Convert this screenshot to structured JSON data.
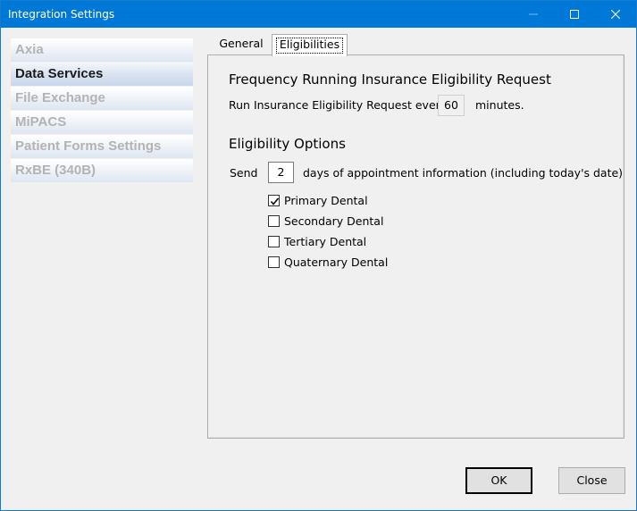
{
  "window": {
    "title": "Integration Settings"
  },
  "sidebar": {
    "items": [
      {
        "label": "Axia",
        "selected": false
      },
      {
        "label": "Data Services",
        "selected": true
      },
      {
        "label": "File Exchange",
        "selected": false
      },
      {
        "label": "MiPACS",
        "selected": false
      },
      {
        "label": "Patient Forms Settings",
        "selected": false
      },
      {
        "label": "RxBE (340B)",
        "selected": false
      }
    ]
  },
  "tabs": [
    {
      "label": "General",
      "active": false
    },
    {
      "label": "Eligibilities",
      "active": true
    }
  ],
  "frequency": {
    "heading": "Frequency Running Insurance Eligibility Request",
    "prefix": "Run Insurance Eligibility Request every",
    "value": "60",
    "suffix": "minutes."
  },
  "options": {
    "heading": "Eligibility Options",
    "send_label": "Send",
    "days_value": "2",
    "days_suffix": "days of appointment information (including today's date)",
    "checkboxes": [
      {
        "label": "Primary Dental",
        "checked": true
      },
      {
        "label": "Secondary Dental",
        "checked": false
      },
      {
        "label": "Tertiary Dental",
        "checked": false
      },
      {
        "label": "Quaternary Dental",
        "checked": false
      }
    ]
  },
  "footer": {
    "ok_label": "OK",
    "close_label": "Close"
  },
  "colors": {
    "titlebar": "#0078d7",
    "selected_item_text": "#1a1a1a",
    "disabled_item_text": "#b3b3b3"
  },
  "icons": [
    "minimize-icon",
    "maximize-icon",
    "close-icon",
    "check-icon"
  ]
}
